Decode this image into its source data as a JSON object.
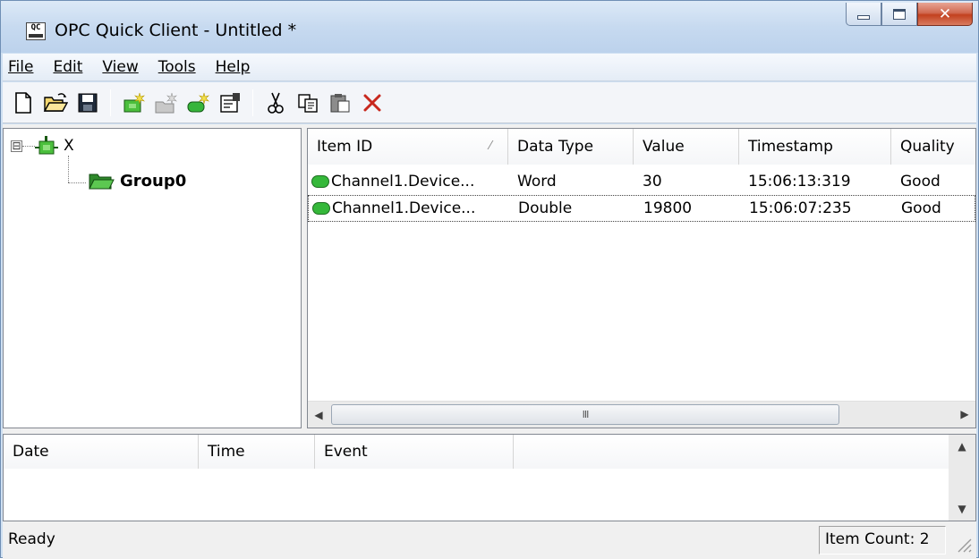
{
  "window": {
    "title": "OPC Quick Client - Untitled *",
    "app_icon_text": "QC"
  },
  "menu": [
    {
      "label": "File",
      "mnemonic_index": 0
    },
    {
      "label": "Edit",
      "mnemonic_index": 0
    },
    {
      "label": "View",
      "mnemonic_index": 0
    },
    {
      "label": "Tools",
      "mnemonic_index": 0
    },
    {
      "label": "Help",
      "mnemonic_index": 0
    }
  ],
  "toolbar": {
    "buttons": [
      "new-icon",
      "open-folder-icon",
      "save-icon",
      "new-server-icon",
      "new-group-icon",
      "new-item-icon",
      "properties-icon",
      "cut-icon",
      "copy-icon",
      "paste-icon",
      "delete-icon"
    ]
  },
  "tree": {
    "root": {
      "label": "X",
      "expander": "⊟"
    },
    "children": [
      {
        "label": "Group0"
      }
    ]
  },
  "items_list": {
    "columns": [
      "Item ID",
      "Data Type",
      "Value",
      "Timestamp",
      "Quality"
    ],
    "sort_indicator": "⁄",
    "rows": [
      {
        "item_id": "Channel1.Device...",
        "data_type": "Word",
        "value": "30",
        "timestamp": "15:06:13:319",
        "quality": "Good"
      },
      {
        "item_id": "Channel1.Device...",
        "data_type": "Double",
        "value": "19800",
        "timestamp": "15:06:07:235",
        "quality": "Good"
      }
    ],
    "scroll_left": "◀",
    "scroll_right": "▶",
    "scroll_thumb_grip": "III"
  },
  "event_log": {
    "columns": [
      "Date",
      "Time",
      "Event",
      ""
    ],
    "scroll_up": "▲",
    "scroll_down": "▼"
  },
  "status": {
    "text": "Ready",
    "item_count": "Item Count: 2"
  }
}
